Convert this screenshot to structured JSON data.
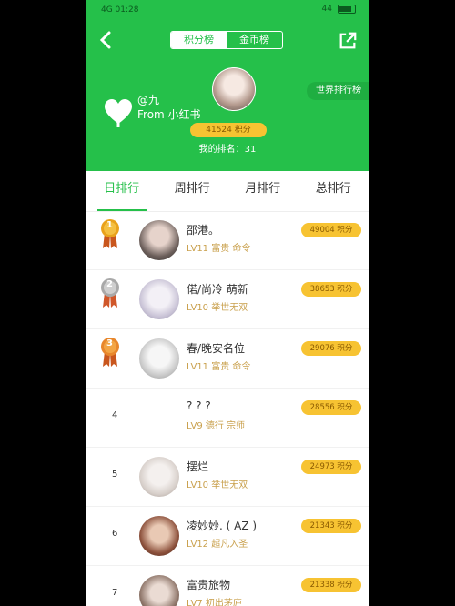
{
  "status": {
    "left": "4G 01:28",
    "right": "44"
  },
  "header": {
    "tab_active": "积分榜",
    "tab_inactive": "金币榜",
    "world_label": "世界排行榜",
    "user_handle": "@九",
    "user_source": "From 小红书",
    "my_points": "41524 积分",
    "my_rank": "我的排名：31"
  },
  "tabs": [
    "日排行",
    "周排行",
    "月排行",
    "总排行"
  ],
  "rows": [
    {
      "rank": "1",
      "name": "邵港。",
      "level": "LV11 富贵 命令",
      "points": "49004 积分",
      "medal": "gold"
    },
    {
      "rank": "2",
      "name": "偌/尚冷 萌新",
      "level": "LV10 举世无双",
      "points": "38653 积分",
      "medal": "silver"
    },
    {
      "rank": "3",
      "name": "春/晚安名位",
      "level": "LV11 富贵 命令",
      "points": "29076 积分",
      "medal": "bronze"
    },
    {
      "rank": "4",
      "name": "? ? ?",
      "level": "LV9 德行 宗师",
      "points": "28556 积分",
      "medal": ""
    },
    {
      "rank": "5",
      "name": "摆烂",
      "level": "LV10 举世无双",
      "points": "24973 积分",
      "medal": ""
    },
    {
      "rank": "6",
      "name": "凌妙妙. ( AZ )",
      "level": "LV12 超凡入圣",
      "points": "21343 积分",
      "medal": ""
    },
    {
      "rank": "7",
      "name": "富贵旅物",
      "level": "LV7 初出茅庐",
      "points": "21338 积分",
      "medal": ""
    }
  ],
  "colors": {
    "primary": "#25c04a",
    "gold": "#f7c332",
    "medal_gold": "#e9a21b",
    "medal_silver": "#b8b8b8",
    "medal_bronze": "#e8872c"
  }
}
